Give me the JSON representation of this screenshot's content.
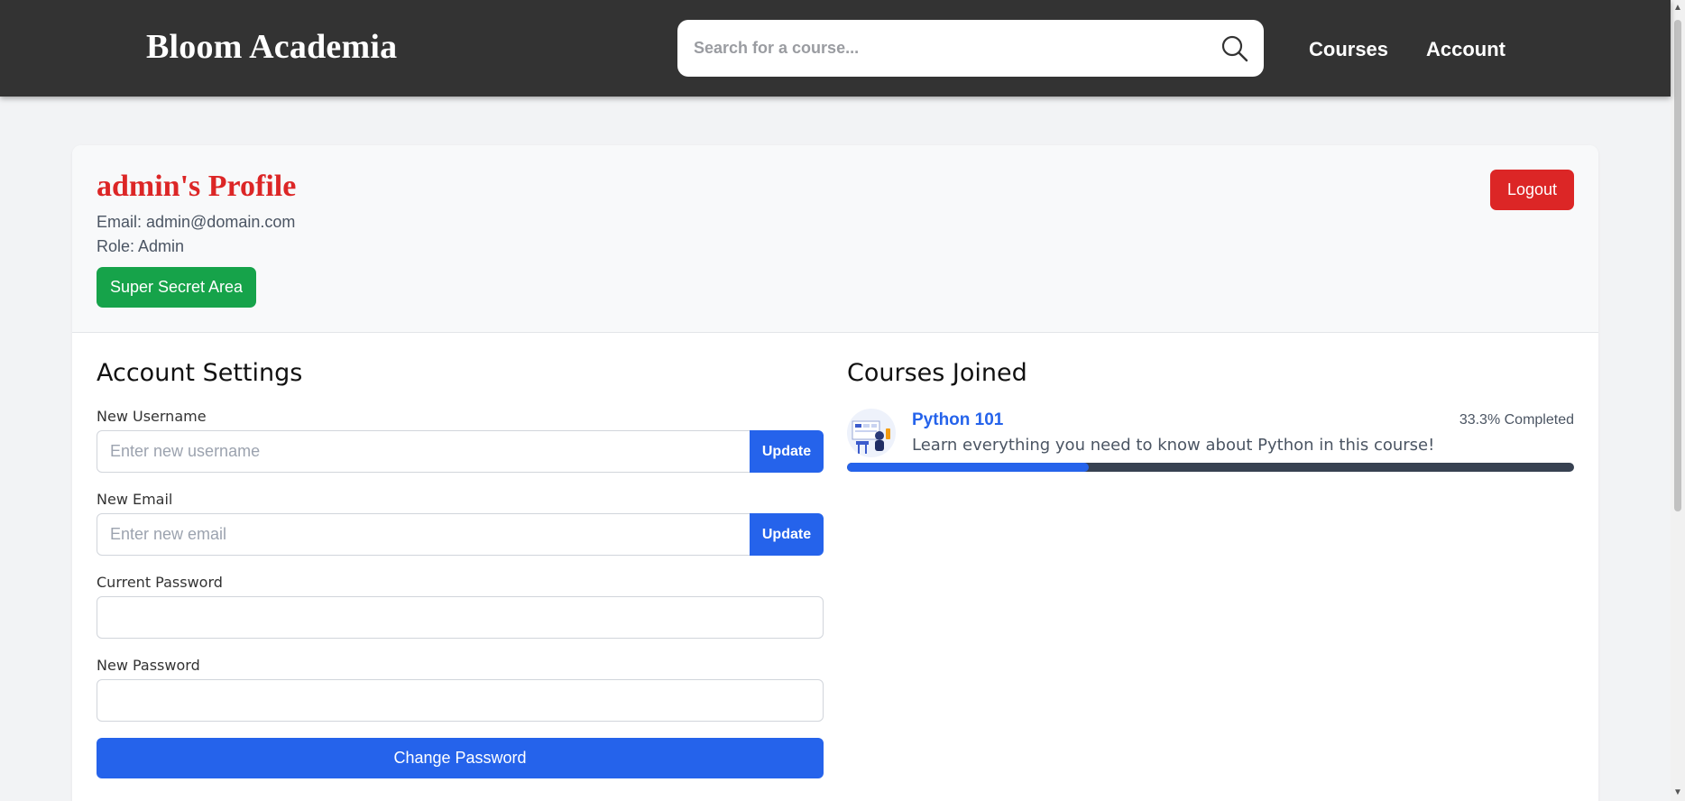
{
  "header": {
    "brand": "Bloom Academia",
    "search_placeholder": "Search for a course...",
    "nav": {
      "courses": "Courses",
      "account": "Account"
    }
  },
  "profile": {
    "title": "admin's Profile",
    "email_line": "Email: admin@domain.com",
    "role_line": "Role: Admin",
    "secret_button": "Super Secret Area",
    "logout_button": "Logout"
  },
  "settings": {
    "heading": "Account Settings",
    "username_label": "New Username",
    "username_placeholder": "Enter new username",
    "email_label": "New Email",
    "email_placeholder": "Enter new email",
    "update_label": "Update",
    "current_password_label": "Current Password",
    "new_password_label": "New Password",
    "change_password_button": "Change Password"
  },
  "courses": {
    "heading": "Courses Joined",
    "items": [
      {
        "title": "Python 101",
        "progress_text": "33.3% Completed",
        "progress": 0.333,
        "description": "Learn everything you need to know about Python in this course!"
      }
    ]
  },
  "colors": {
    "header_bg": "#333333",
    "accent_blue": "#2563eb",
    "danger_red": "#dc2626",
    "success_green": "#16a34a"
  }
}
